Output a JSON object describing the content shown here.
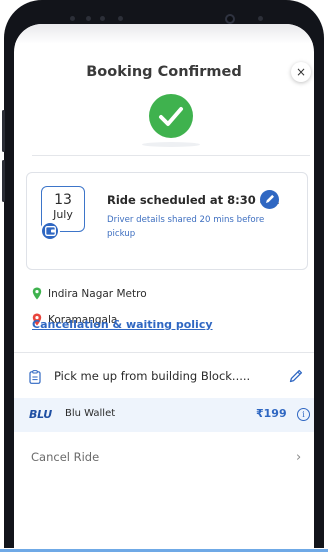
{
  "header": {
    "title": "Booking Confirmed",
    "close_label": "×"
  },
  "schedule": {
    "date_day": "13",
    "date_month": "July",
    "title": "Ride scheduled at 8:30 am",
    "subtitle": "Driver details shared 20 mins before pickup"
  },
  "locations": {
    "pickup": "Indira Nagar Metro",
    "drop": "Koramangala"
  },
  "policy_link": "Cancellation & waiting policy",
  "pickup_note": "Pick me up from building Block.....",
  "wallet": {
    "logo": "BLU",
    "label": "Blu Wallet",
    "amount": "₹199",
    "info": "i"
  },
  "cancel": {
    "label": "Cancel Ride",
    "chevron": "›"
  },
  "colors": {
    "accent": "#2f67c2",
    "success": "#3fb24e",
    "pickup_pin": "#3fb24e",
    "drop_pin": "#e8453c"
  }
}
